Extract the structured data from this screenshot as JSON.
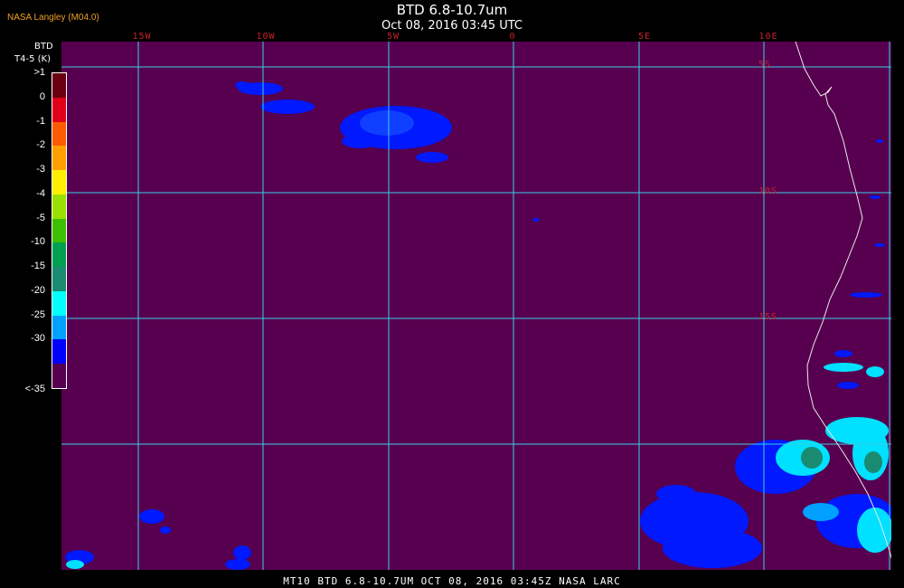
{
  "header": {
    "credit": "NASA Langley (M04.0)",
    "title": "BTD 6.8-10.7um",
    "subtitle": "Oct 08, 2016 03:45 UTC"
  },
  "map": {
    "background_color": "#57004f",
    "gridline_color": "#3ad0e6",
    "coastline_color": "#e8e8e8",
    "longitude_labels": [
      "15W",
      "10W",
      "5W",
      "0",
      "5E",
      "10E"
    ],
    "latitude_labels": [
      "5S",
      "10S",
      "15S"
    ]
  },
  "legend": {
    "title": "BTD",
    "units": "T4-5 (K)",
    "classes": [
      {
        "label": ">1",
        "color": "#6a0010"
      },
      {
        "label": "0",
        "color": "#e0001a"
      },
      {
        "label": "-1",
        "color": "#ff5a00"
      },
      {
        "label": "-2",
        "color": "#ffa000"
      },
      {
        "label": "-3",
        "color": "#ffee00"
      },
      {
        "label": "-4",
        "color": "#9ae000"
      },
      {
        "label": "-5",
        "color": "#3cc000"
      },
      {
        "label": "-10",
        "color": "#00a050"
      },
      {
        "label": "-15",
        "color": "#1a8a70"
      },
      {
        "label": "-20",
        "color": "#00ffff"
      },
      {
        "label": "-25",
        "color": "#00a0ff"
      },
      {
        "label": "-30",
        "color": "#0000ff"
      },
      {
        "label": "<-35",
        "color": "#57004f"
      }
    ]
  },
  "footer": {
    "text": "MT10  BTD 6.8-10.7UM   OCT 08, 2016 03:45Z   NASA LARC"
  }
}
